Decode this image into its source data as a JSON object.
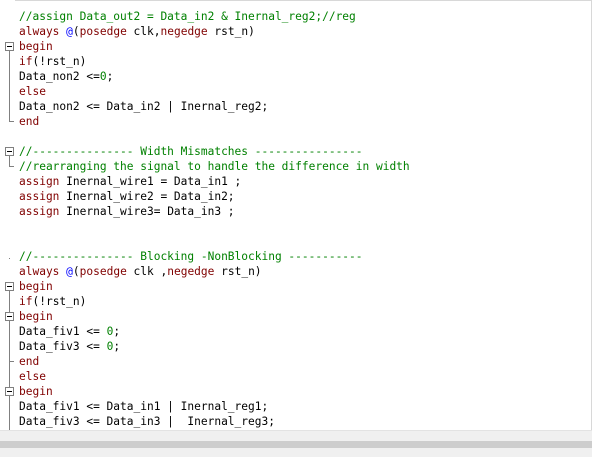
{
  "colors": {
    "comment": "#008000",
    "keyword": "#800000",
    "number": "#008000",
    "text": "#000000",
    "background": "#ffffff"
  },
  "lines": [
    [
      {
        "t": "//assign Data_out2 = Data_in2 & Inernal_reg2;//reg",
        "c": "comment"
      }
    ],
    [
      {
        "t": "always",
        "c": "kw"
      },
      {
        "t": " @",
        "c": "blue"
      },
      {
        "t": "(",
        "c": "id"
      },
      {
        "t": "posedge",
        "c": "kw"
      },
      {
        "t": " clk,",
        "c": "id"
      },
      {
        "t": "negedge",
        "c": "kw"
      },
      {
        "t": " rst_n)",
        "c": "id"
      }
    ],
    [
      {
        "t": "begin",
        "c": "kw"
      }
    ],
    [
      {
        "t": "if",
        "c": "kw"
      },
      {
        "t": "(!rst_n)",
        "c": "id"
      }
    ],
    [
      {
        "t": "Data_non2 <=",
        "c": "id"
      },
      {
        "t": "0",
        "c": "num"
      },
      {
        "t": ";",
        "c": "id"
      }
    ],
    [
      {
        "t": "else",
        "c": "kw"
      }
    ],
    [
      {
        "t": "Data_non2 <= Data_in2 | Inernal_reg2;",
        "c": "id"
      }
    ],
    [
      {
        "t": "end",
        "c": "kw"
      }
    ],
    [
      {
        "t": "",
        "c": "id"
      }
    ],
    [
      {
        "t": "//--------------- Width Mismatches ----------------",
        "c": "comment"
      }
    ],
    [
      {
        "t": "//rearranging the signal to handle the difference in width",
        "c": "comment"
      }
    ],
    [
      {
        "t": "assign",
        "c": "kw"
      },
      {
        "t": " Inernal_wire1 = Data_in1 ;",
        "c": "id"
      }
    ],
    [
      {
        "t": "assign",
        "c": "kw"
      },
      {
        "t": " Inernal_wire2 = Data_in2;",
        "c": "id"
      }
    ],
    [
      {
        "t": "assign",
        "c": "kw"
      },
      {
        "t": " Inernal_wire3= Data_in3 ;",
        "c": "id"
      }
    ],
    [
      {
        "t": "",
        "c": "id"
      }
    ],
    [
      {
        "t": "",
        "c": "id"
      }
    ],
    [
      {
        "t": "//--------------- Blocking -NonBlocking -----------",
        "c": "comment"
      }
    ],
    [
      {
        "t": "always",
        "c": "kw"
      },
      {
        "t": " @",
        "c": "blue"
      },
      {
        "t": "(",
        "c": "id"
      },
      {
        "t": "posedge",
        "c": "kw"
      },
      {
        "t": " clk ,",
        "c": "id"
      },
      {
        "t": "negedge",
        "c": "kw"
      },
      {
        "t": " rst_n)",
        "c": "id"
      }
    ],
    [
      {
        "t": "begin",
        "c": "kw"
      }
    ],
    [
      {
        "t": "if",
        "c": "kw"
      },
      {
        "t": "(!rst_n)",
        "c": "id"
      }
    ],
    [
      {
        "t": "begin",
        "c": "kw"
      }
    ],
    [
      {
        "t": "Data_fiv1 <= ",
        "c": "id"
      },
      {
        "t": "0",
        "c": "num"
      },
      {
        "t": ";",
        "c": "id"
      }
    ],
    [
      {
        "t": "Data_fiv3 <= ",
        "c": "id"
      },
      {
        "t": "0",
        "c": "num"
      },
      {
        "t": ";",
        "c": "id"
      }
    ],
    [
      {
        "t": "end",
        "c": "kw"
      }
    ],
    [
      {
        "t": "else",
        "c": "kw"
      }
    ],
    [
      {
        "t": "begin",
        "c": "kw"
      }
    ],
    [
      {
        "t": "Data_fiv1 <= Data_in1 | Inernal_reg1;",
        "c": "id"
      }
    ],
    [
      {
        "t": "Data_fiv3 <= Data_in3 |  Inernal_reg3;",
        "c": "id"
      }
    ]
  ]
}
